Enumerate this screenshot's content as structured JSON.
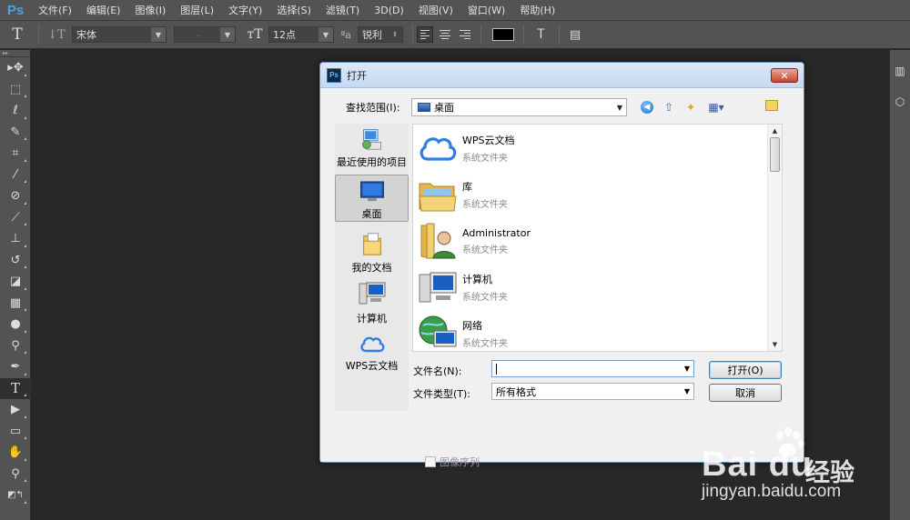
{
  "app": {
    "logo": "Ps",
    "menu": [
      "文件(F)",
      "编辑(E)",
      "图像(I)",
      "图层(L)",
      "文字(Y)",
      "选择(S)",
      "滤镜(T)",
      "3D(D)",
      "视图(V)",
      "窗口(W)",
      "帮助(H)"
    ]
  },
  "options": {
    "font_family": "宋体",
    "font_style": "-",
    "font_size": "12点",
    "aa_label": "ªa",
    "antialias": "锐利",
    "text_color": "#000000"
  },
  "tools": [
    "move-tool",
    "marquee-tool",
    "lasso-tool",
    "quick-select-tool",
    "crop-tool",
    "eyedropper-tool",
    "healing-brush-tool",
    "brush-tool",
    "clone-stamp-tool",
    "history-brush-tool",
    "eraser-tool",
    "gradient-tool",
    "blur-tool",
    "dodge-tool",
    "pen-tool",
    "type-tool",
    "path-select-tool",
    "rectangle-tool",
    "hand-tool",
    "zoom-tool"
  ],
  "dialog": {
    "title": "打开",
    "look_in_label": "查找范围(I):",
    "look_in_value": "桌面",
    "places": [
      {
        "label": "最近使用的项目",
        "icon": "recent-items-icon"
      },
      {
        "label": "桌面",
        "icon": "desktop-icon",
        "selected": true
      },
      {
        "label": "我的文档",
        "icon": "documents-icon"
      },
      {
        "label": "计算机",
        "icon": "computer-icon"
      },
      {
        "label": "WPS云文档",
        "icon": "cloud-icon"
      }
    ],
    "files": [
      {
        "name": "WPS云文档",
        "type": "系统文件夹",
        "icon": "cloud-icon"
      },
      {
        "name": "库",
        "type": "系统文件夹",
        "icon": "library-icon"
      },
      {
        "name": "Administrator",
        "type": "系统文件夹",
        "icon": "user-folder-icon"
      },
      {
        "name": "计算机",
        "type": "系统文件夹",
        "icon": "computer-icon"
      },
      {
        "name": "网络",
        "type": "系统文件夹",
        "icon": "network-icon"
      }
    ],
    "filename_label": "文件名(N):",
    "filename_value": "",
    "filetype_label": "文件类型(T):",
    "filetype_value": "所有格式",
    "open_button": "打开(O)",
    "cancel_button": "取消",
    "image_sequence_label": "图像序列"
  },
  "watermark": {
    "logo_text": "Bai du",
    "cn_text": "经验",
    "url": "jingyan.baidu.com"
  }
}
